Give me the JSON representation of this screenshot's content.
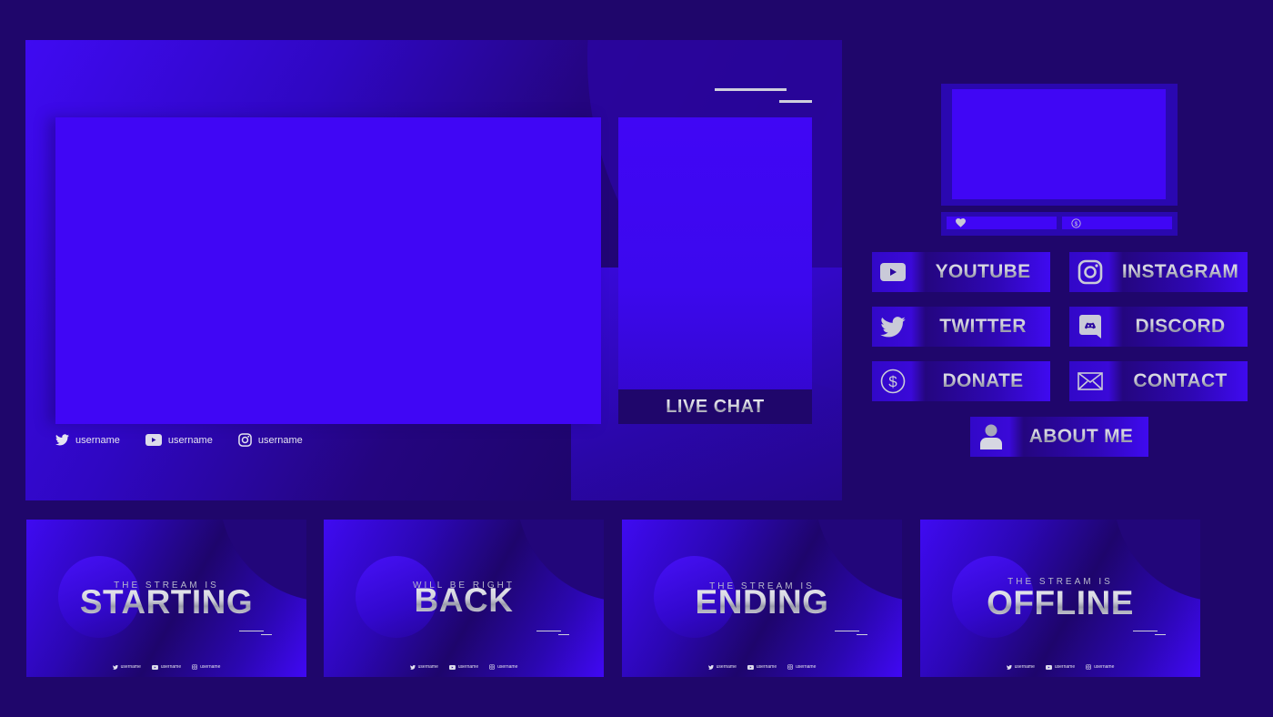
{
  "colors": {
    "background": "#1f066b",
    "accent": "#4006f5",
    "panel_dark": "#2a08b0",
    "text_silver": "#cfd0dc"
  },
  "main_overlay": {
    "live_chat_label": "LIVE CHAT",
    "socials": [
      {
        "icon": "twitter-icon",
        "label": "username"
      },
      {
        "icon": "youtube-icon",
        "label": "username"
      },
      {
        "icon": "instagram-icon",
        "label": "username"
      }
    ]
  },
  "goal_bars": [
    {
      "icon": "heart-icon"
    },
    {
      "icon": "dollar-coin-icon"
    }
  ],
  "panels": [
    {
      "icon": "youtube-icon",
      "label": "YOUTUBE"
    },
    {
      "icon": "instagram-icon",
      "label": "INSTAGRAM"
    },
    {
      "icon": "twitter-icon",
      "label": "TWITTER"
    },
    {
      "icon": "discord-icon",
      "label": "DISCORD"
    },
    {
      "icon": "dollar-coin-icon",
      "label": "DONATE"
    },
    {
      "icon": "mail-icon",
      "label": "CONTACT"
    },
    {
      "icon": "user-icon",
      "label": "ABOUT ME"
    }
  ],
  "scenes": [
    {
      "subtitle": "THE STREAM IS",
      "title": "STARTING",
      "socials": [
        "username",
        "username",
        "username"
      ]
    },
    {
      "subtitle": "WILL BE RIGHT",
      "title": "BACK",
      "socials": [
        "username",
        "username",
        "username"
      ]
    },
    {
      "subtitle": "THE STREAM IS",
      "title": "ENDING",
      "socials": [
        "username",
        "username",
        "username"
      ]
    },
    {
      "subtitle": "THE STREAM IS",
      "title": "OFFLINE",
      "socials": [
        "username",
        "username",
        "username"
      ]
    }
  ]
}
